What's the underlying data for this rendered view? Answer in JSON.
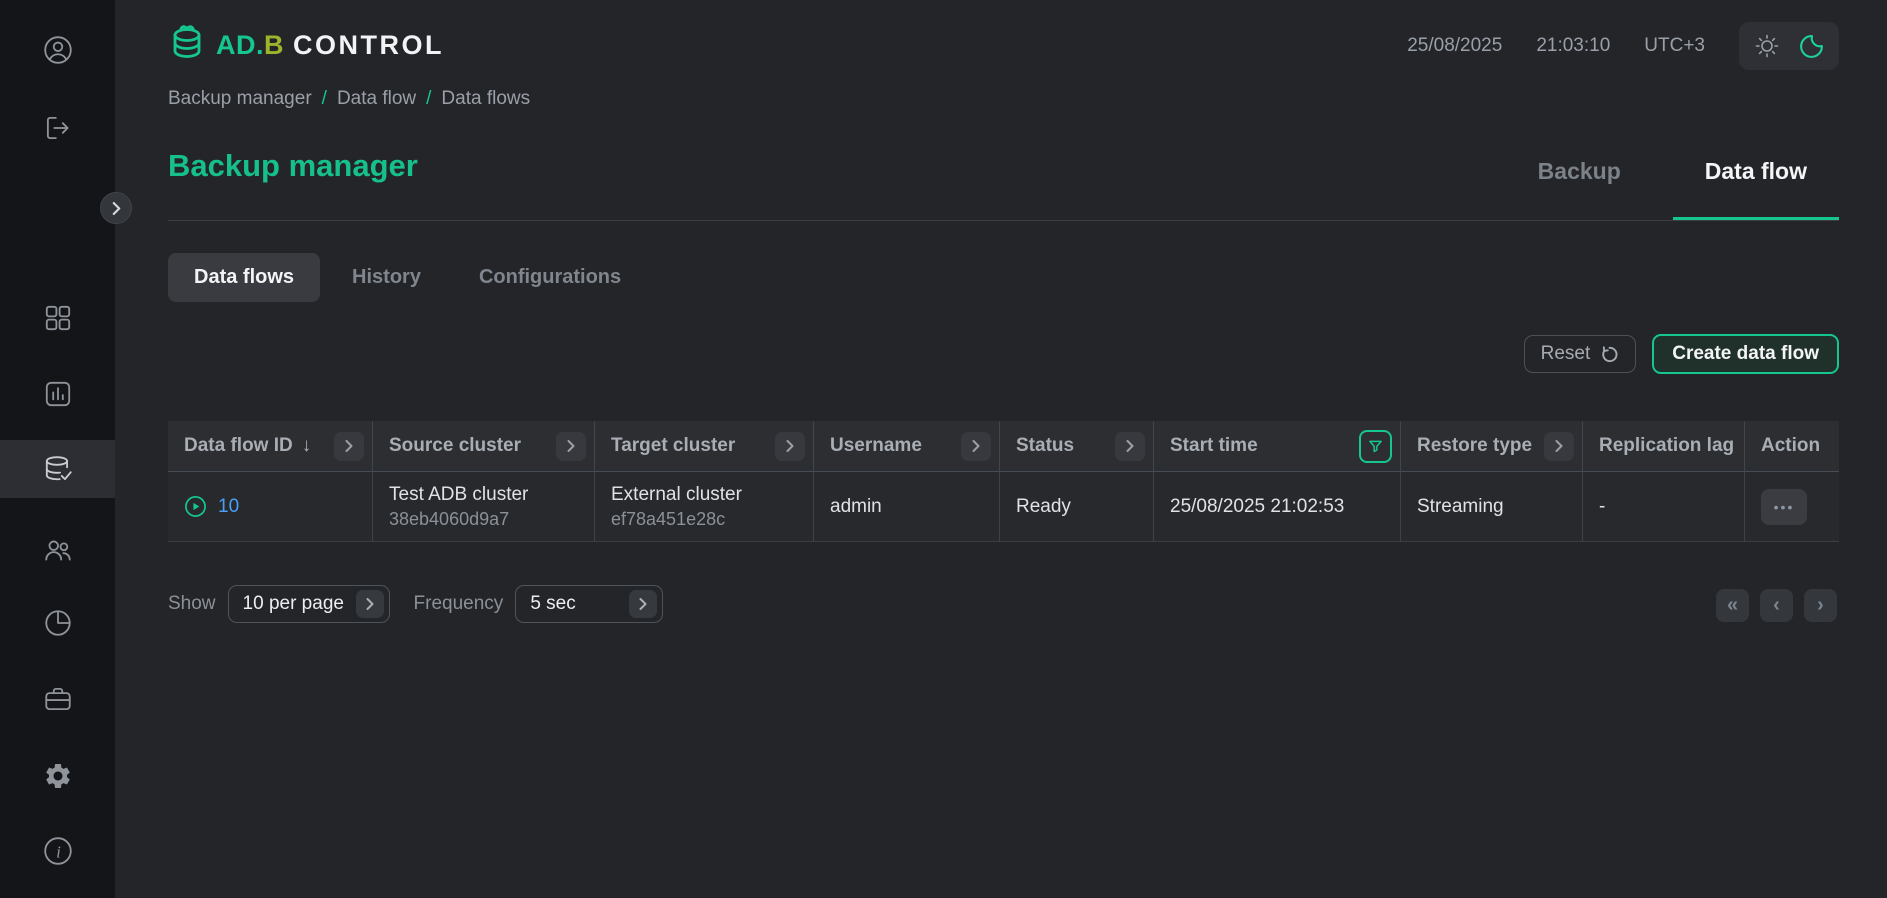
{
  "brand": {
    "part1": "AD.",
    "part2": "B",
    "part3": "CONTROL"
  },
  "clock": {
    "date": "25/08/2025",
    "time": "21:03:10",
    "timezone": "UTC+3"
  },
  "breadcrumb": {
    "separator": "/",
    "items": [
      "Backup manager",
      "Data flow",
      "Data flows"
    ]
  },
  "page_title": "Backup manager",
  "tabs": [
    {
      "label": "Backup",
      "active": false
    },
    {
      "label": "Data flow",
      "active": true
    }
  ],
  "subtabs": [
    {
      "label": "Data flows",
      "active": true
    },
    {
      "label": "History",
      "active": false
    },
    {
      "label": "Configurations",
      "active": false
    }
  ],
  "toolbar": {
    "reset_label": "Reset",
    "create_label": "Create data flow"
  },
  "table": {
    "columns": [
      {
        "label": "Data flow ID",
        "sorted": "desc",
        "menu": true
      },
      {
        "label": "Source cluster",
        "menu": true
      },
      {
        "label": "Target cluster",
        "menu": true
      },
      {
        "label": "Username",
        "menu": true
      },
      {
        "label": "Status",
        "menu": true
      },
      {
        "label": "Start time",
        "filter_active": true
      },
      {
        "label": "Restore type",
        "menu": true
      },
      {
        "label": "Replication lag"
      },
      {
        "label": "Action"
      }
    ],
    "rows": [
      {
        "id": "10",
        "source_name": "Test ADB cluster",
        "source_id": "38eb4060d9a7",
        "target_name": "External cluster",
        "target_id": "ef78a451e28c",
        "username": "admin",
        "status": "Ready",
        "start_time": "25/08/2025 21:02:53",
        "restore_type": "Streaming",
        "replication_lag": "-"
      }
    ]
  },
  "footer": {
    "show_label": "Show",
    "page_size_value": "10 per page",
    "frequency_label": "Frequency",
    "frequency_value": "5 sec"
  },
  "glyphs": {
    "sort_desc": "↓",
    "first_page": "«",
    "prev_page": "‹",
    "next_page": "›",
    "more_actions": "•••"
  },
  "colors": {
    "accent": "#16c68f",
    "logo_b": "#9db32b",
    "link_blue": "#4aa0f5"
  },
  "sidebar_icons": [
    "user-circle",
    "logout",
    "grid",
    "bar-chart",
    "database-check",
    "users",
    "pie-chart",
    "briefcase",
    "gear",
    "info"
  ]
}
